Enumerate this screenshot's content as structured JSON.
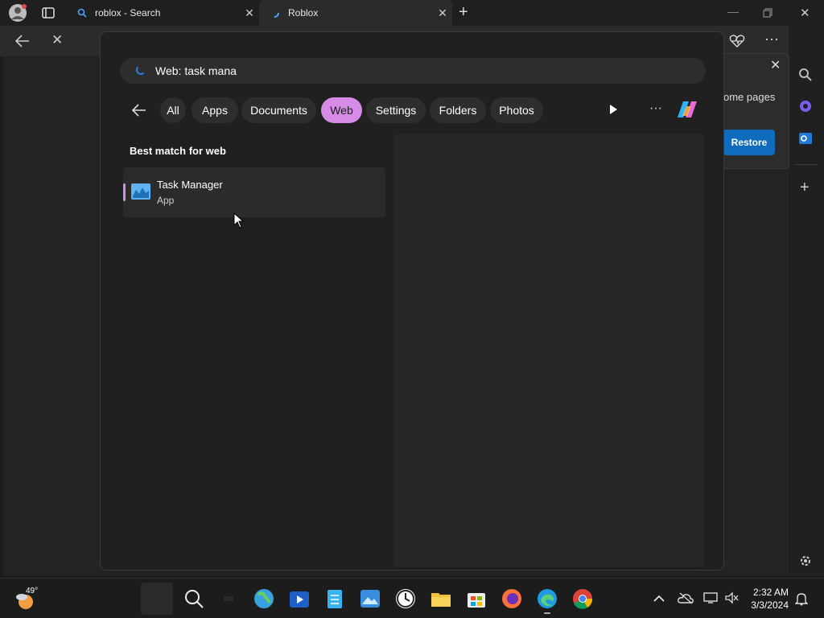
{
  "browser": {
    "tabs": [
      {
        "title": "roblox - Search"
      },
      {
        "title": "Roblox"
      }
    ],
    "new_tab_label": "+"
  },
  "restore_panel": {
    "text": "ome pages",
    "button": "Restore"
  },
  "search": {
    "query": "Web: task mana",
    "filters": [
      {
        "label": "All"
      },
      {
        "label": "Apps"
      },
      {
        "label": "Documents"
      },
      {
        "label": "Web",
        "active": true
      },
      {
        "label": "Settings"
      },
      {
        "label": "Folders"
      },
      {
        "label": "Photos"
      }
    ],
    "section_title": "Best match for web",
    "best_match": {
      "name": "Task Manager",
      "kind": "App"
    }
  },
  "taskbar": {
    "weather_temp": "49°",
    "time": "2:32 AM",
    "date": "3/3/2024"
  },
  "colors": {
    "accent": "#d68ce6",
    "restore_button": "#0f6cbd"
  }
}
